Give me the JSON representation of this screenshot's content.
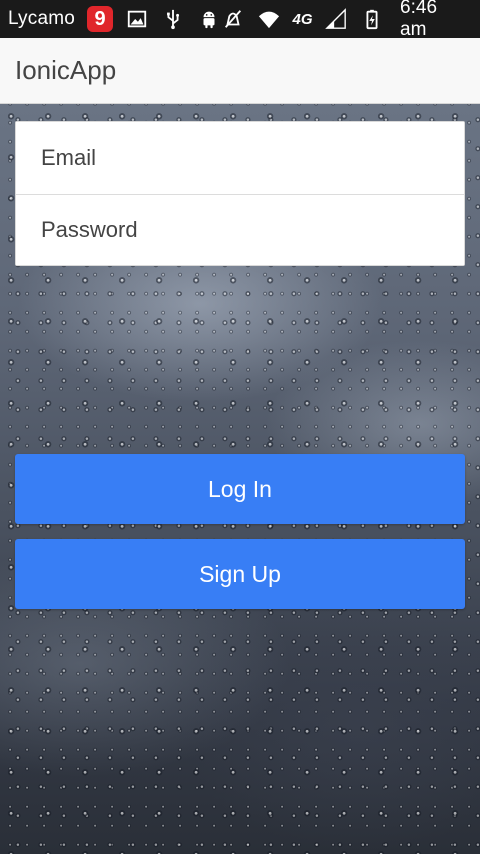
{
  "status_bar": {
    "carrier": "Lycamo",
    "notification_badge": "9",
    "network_type": "4G",
    "time": "6:46 am",
    "icons": [
      "image-icon",
      "usb-icon",
      "android-icon",
      "mute-icon",
      "wifi-icon",
      "signal-icon",
      "battery-icon"
    ]
  },
  "header": {
    "title": "IonicApp"
  },
  "login_form": {
    "email_placeholder": "Email",
    "email_value": "",
    "password_placeholder": "Password",
    "password_value": ""
  },
  "actions": {
    "login_label": "Log In",
    "signup_label": "Sign Up"
  },
  "colors": {
    "primary_button": "#387ef5",
    "header_bg": "#f8f8f8",
    "status_bar_bg": "#1a1a1a",
    "badge": "#e0262b"
  }
}
